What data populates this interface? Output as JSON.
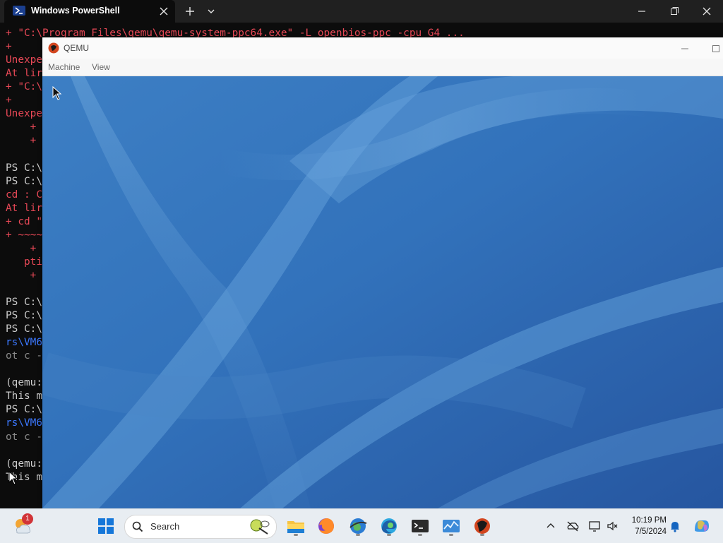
{
  "powershell": {
    "tab_title": "Windows PowerShell",
    "console_lines": [
      {
        "text": "+ \"C:\\Program Files\\qemu\\qemu-system-ppc64.exe\" -L openbios-ppc -cpu G4 ...",
        "color": "red"
      },
      {
        "text": "+",
        "color": "red"
      },
      {
        "text": "Unexpe",
        "color": "red"
      },
      {
        "text": "At lir",
        "color": "red"
      },
      {
        "text": "+ \"C:\\",
        "color": "red"
      },
      {
        "text": "+",
        "color": "red"
      },
      {
        "text": "Unexpe",
        "color": "red"
      },
      {
        "text": "    +",
        "color": "red"
      },
      {
        "text": "    +",
        "color": "red"
      },
      {
        "text": "",
        "color": "white"
      },
      {
        "text": "PS C:\\",
        "color": "white"
      },
      {
        "text": "PS C:\\",
        "color": "white"
      },
      {
        "text": "cd : C",
        "color": "red"
      },
      {
        "text": "At lir",
        "color": "red"
      },
      {
        "text": "+ cd \"",
        "color": "red"
      },
      {
        "text": "+ ~~~~",
        "color": "red"
      },
      {
        "text": "    +",
        "color": "red"
      },
      {
        "text": "   pti",
        "color": "red"
      },
      {
        "text": "    +",
        "color": "red"
      },
      {
        "text": "",
        "color": "white"
      },
      {
        "text": "PS C:\\",
        "color": "white"
      },
      {
        "text": "PS C:\\",
        "color": "white"
      },
      {
        "text": "PS C:\\",
        "color": "white"
      },
      {
        "text": "rs\\VM6",
        "color": "blue"
      },
      {
        "text": "ot c -",
        "color": "gray"
      },
      {
        "text": "",
        "color": "white"
      },
      {
        "text": "(qemu:",
        "color": "white"
      },
      {
        "text": "This m",
        "color": "white"
      },
      {
        "text": "PS C:\\",
        "color": "white"
      },
      {
        "text": "rs\\VM6",
        "color": "blue"
      },
      {
        "text": "ot c -",
        "color": "gray"
      },
      {
        "text": "",
        "color": "white"
      },
      {
        "text": "(qemu:",
        "color": "white"
      },
      {
        "text": "This m",
        "color": "white"
      }
    ]
  },
  "qemu": {
    "title": "QEMU",
    "menu": [
      "Machine",
      "View"
    ]
  },
  "taskbar": {
    "search_placeholder": "Search",
    "weather_badge": "1",
    "time": "10:19 PM",
    "date": "7/5/2024",
    "apps": [
      "start-button",
      "file-explorer",
      "firefox",
      "network-globe",
      "edge",
      "terminal",
      "task-manager",
      "qemu"
    ]
  },
  "colors": {
    "console_red": "#e74856",
    "console_blue": "#3b78ff",
    "desktop_blue": "#2d66ad"
  }
}
